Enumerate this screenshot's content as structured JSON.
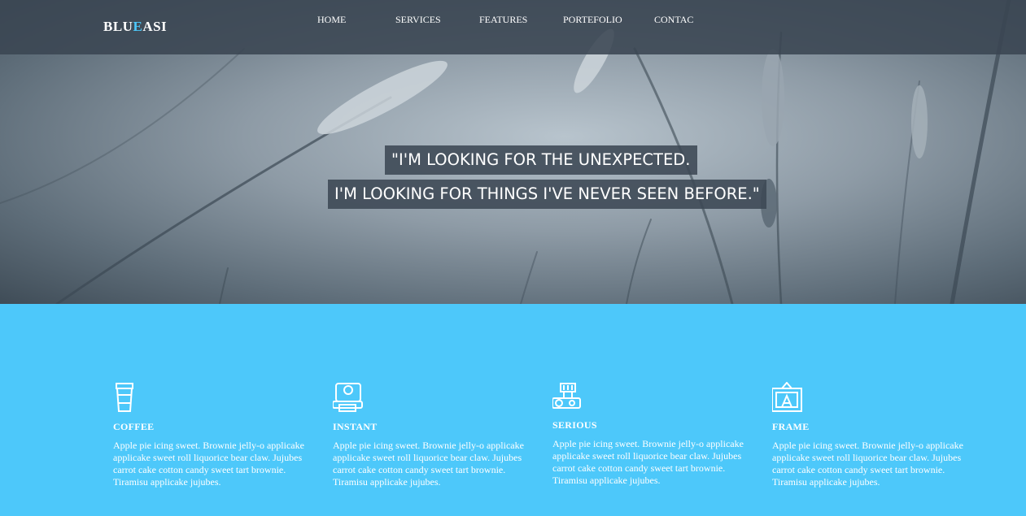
{
  "brand": {
    "logo_parts": [
      "BLU",
      "E",
      "ASI"
    ],
    "accent_color": "#4dc8fa"
  },
  "nav": {
    "items": [
      "HOME",
      "SERVICES",
      "FEATURES",
      "PORTEFOLIO",
      "CONTAC"
    ]
  },
  "hero": {
    "line1": "\"I'M LOOKING FOR THE UNEXPECTED.",
    "line2": "I'M LOOKING FOR THINGS I'VE NEVER SEEN BEFORE.\""
  },
  "features": [
    {
      "icon": "coffee-cup-icon",
      "title": "COFFEE",
      "text": "Apple pie icing sweet. Brownie jelly-o applicake applicake sweet roll liquorice bear claw. Jujubes carrot cake cotton candy sweet tart brownie. Tiramisu applicake jujubes."
    },
    {
      "icon": "instant-camera-icon",
      "title": "INSTANT",
      "text": "Apple pie icing sweet. Brownie jelly-o applicake applicake sweet roll liquorice bear claw. Jujubes carrot cake cotton candy sweet tart brownie. Tiramisu applicake jujubes."
    },
    {
      "icon": "camera-flash-icon",
      "title": "SERIOUS",
      "text": "Apple pie icing sweet. Brownie jelly-o applicake applicake sweet roll liquorice bear claw. Jujubes carrot cake cotton candy sweet tart brownie. Tiramisu applicake jujubes."
    },
    {
      "icon": "picture-frame-icon",
      "title": "FRAME",
      "text": "Apple pie icing sweet. Brownie jelly-o applicake applicake sweet roll liquorice bear claw. Jujubes carrot cake cotton candy sweet tart brownie. Tiramisu applicake jujubes."
    }
  ],
  "colors": {
    "section_bg": "#4dc8fa",
    "header_bg": "#3a4652",
    "text": "#ffffff"
  }
}
